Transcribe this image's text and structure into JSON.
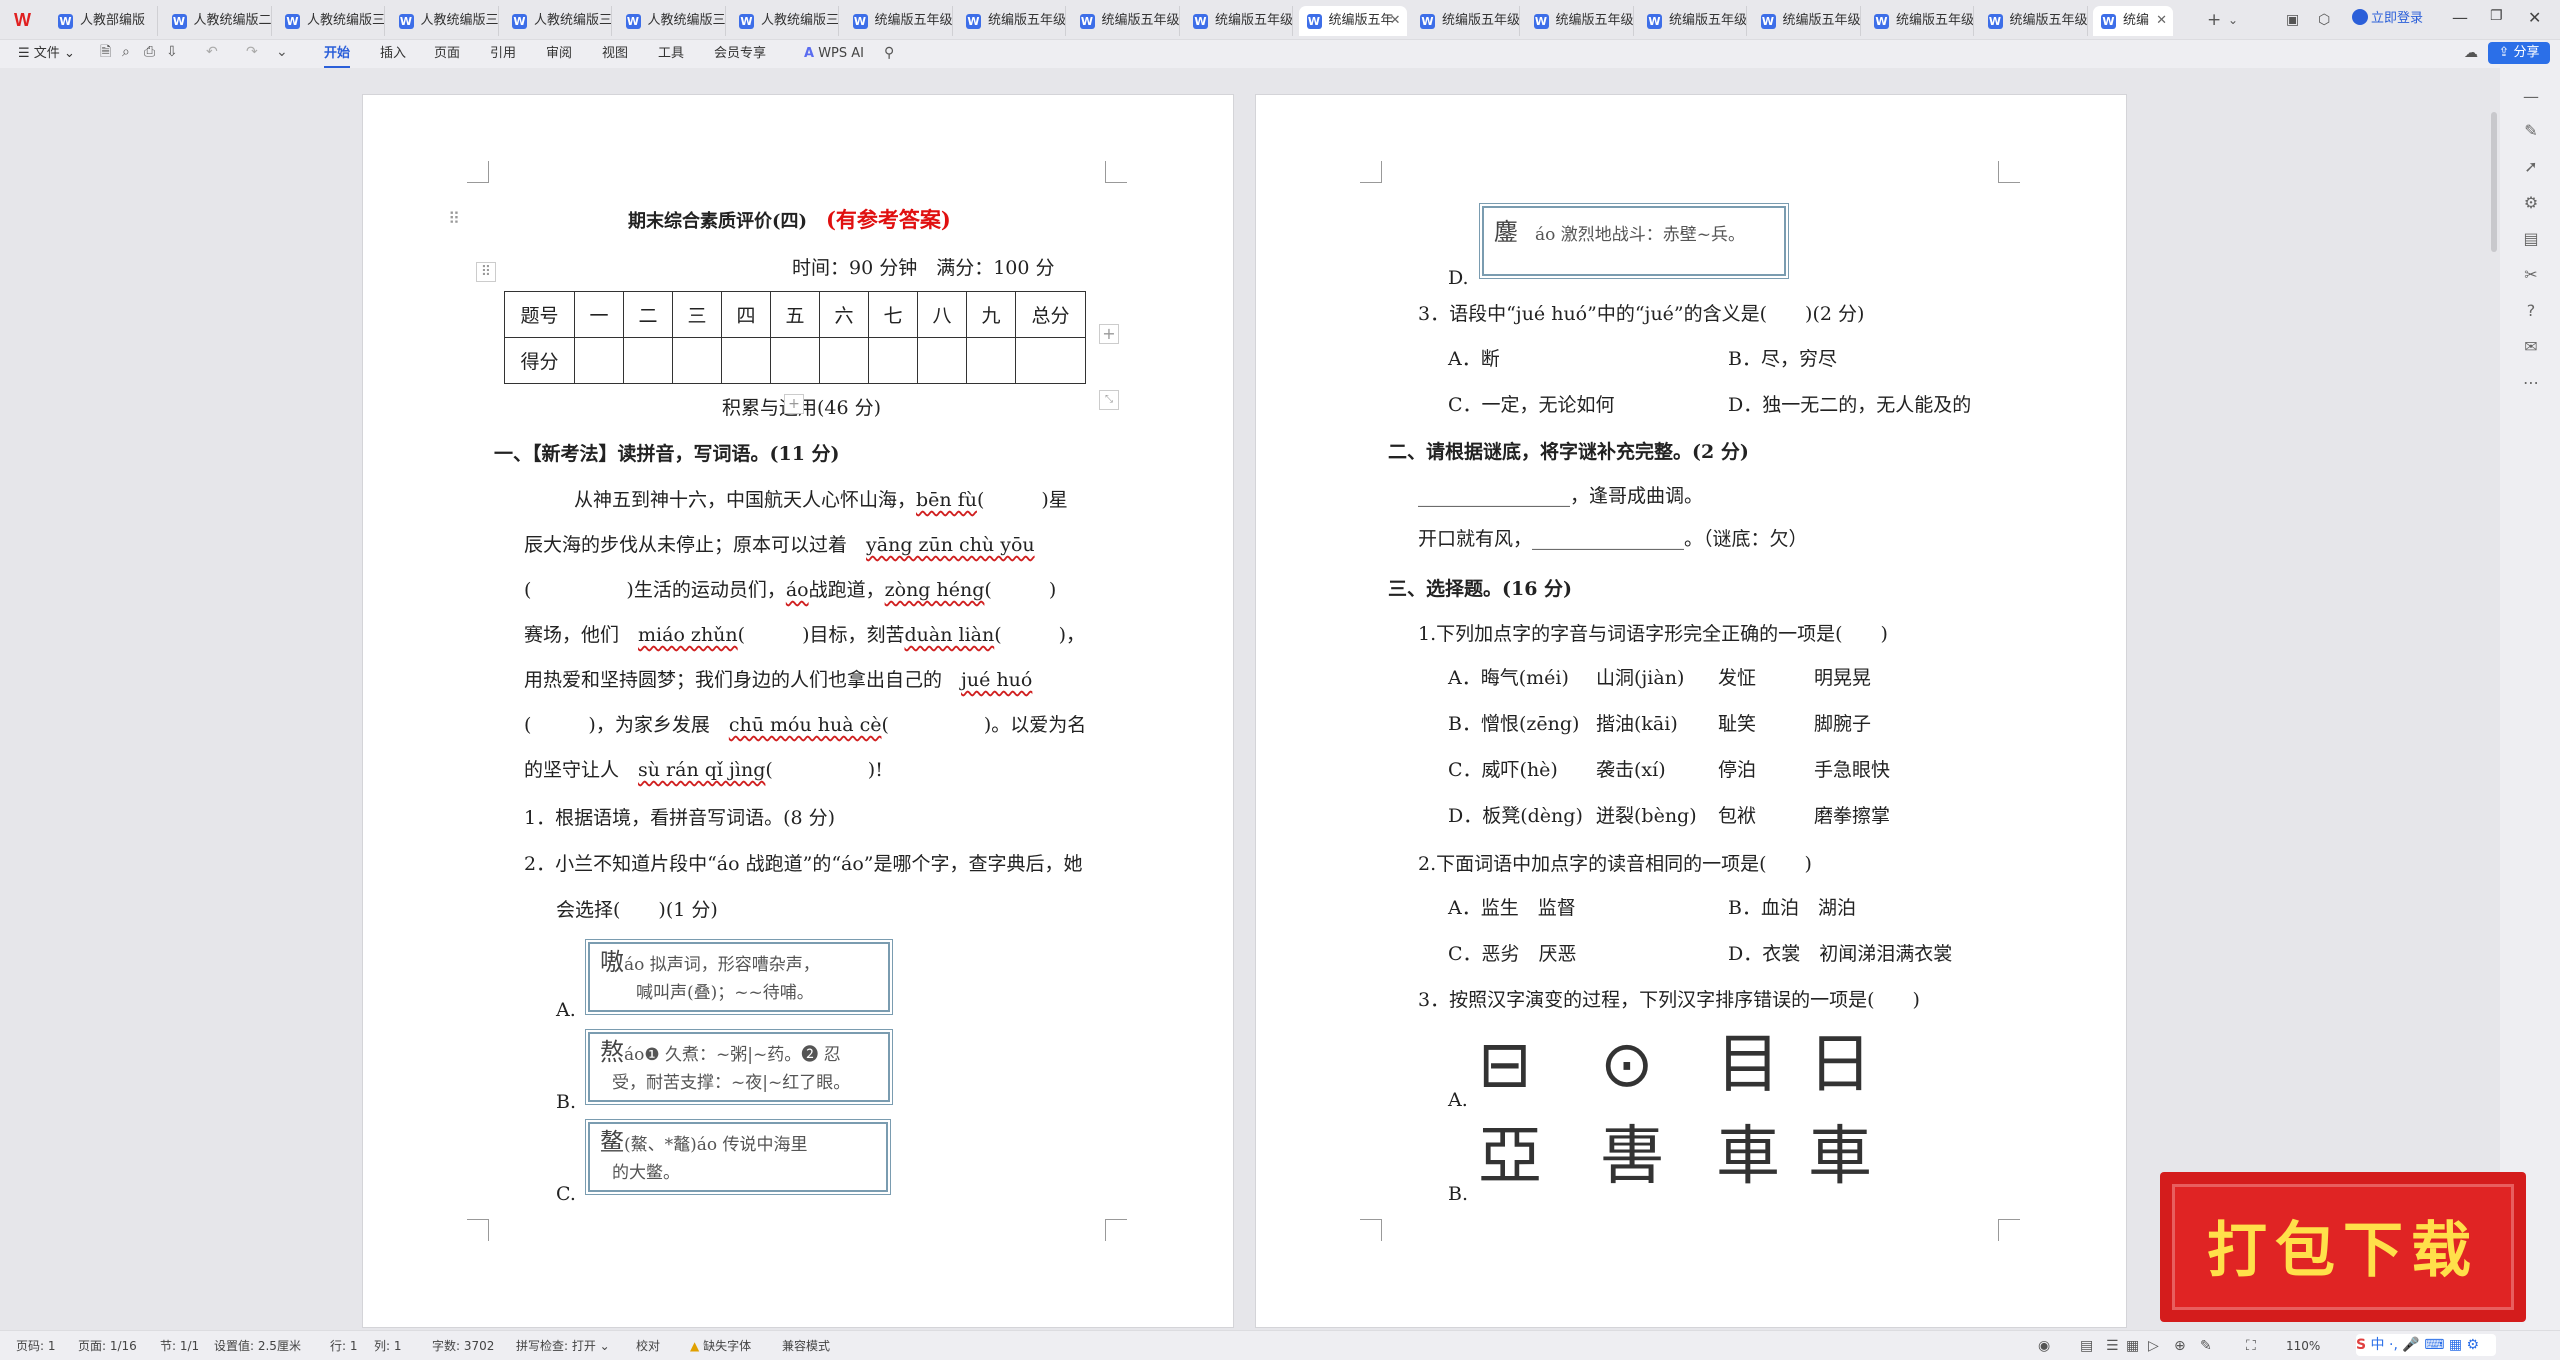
{
  "tabs": [
    {
      "label": "人教部编版"
    },
    {
      "label": "人教统编版二"
    },
    {
      "label": "人教统编版三"
    },
    {
      "label": "人教统编版三"
    },
    {
      "label": "人教统编版三"
    },
    {
      "label": "人教统编版三"
    },
    {
      "label": "人教统编版三"
    },
    {
      "label": "统编版五年级"
    },
    {
      "label": "统编版五年级"
    },
    {
      "label": "统编版五年级"
    },
    {
      "label": "统编版五年级"
    },
    {
      "label": "统编版五年"
    },
    {
      "label": "统编版五年级"
    },
    {
      "label": "统编版五年级"
    },
    {
      "label": "统编版五年级"
    },
    {
      "label": "统编版五年级"
    },
    {
      "label": "统编版五年级"
    },
    {
      "label": "统编版五年级"
    },
    {
      "label": "统编"
    }
  ],
  "login_label": "立即登录",
  "menu": {
    "file": "文件",
    "items": [
      "开始",
      "插入",
      "页面",
      "引用",
      "审阅",
      "视图",
      "工具",
      "会员专享"
    ],
    "wps_ai": "WPS AI",
    "share": "分享"
  },
  "page1": {
    "title": "期末综合素质评价(四)",
    "title_note": "(有参考答案)",
    "time_line": "时间：90 分钟　满分：100 分",
    "table_header": [
      "题号",
      "一",
      "二",
      "三",
      "四",
      "五",
      "六",
      "七",
      "八",
      "九",
      "总分"
    ],
    "table_row_label": "得分",
    "section": "积累与运用(46 分)",
    "q1_title": "一、【新考法】读拼音，写词语。(11 分)",
    "q1_lines": [
      "从神五到神十六，中国航天人心怀山海，",
      "辰大海的步伐从未停止；原本可以过着",
      "(　　　　　)生活的运动员们，",
      "赛场，他们",
      "用热爱和坚持圆梦；我们身边的人们也拿出自己的",
      "(　　　)，为家乡发展",
      "的坚守让人"
    ],
    "pinyin": {
      "p1": "bēn fù",
      "p2": "yāng zūn chù yōu",
      "p3": "áo",
      "p4": "zòng héng",
      "p5": "miáo zhǔn",
      "p6": "duàn liàn",
      "p7": "jué huó",
      "p8": "chū móu huà cè",
      "p9": "sù rán qǐ jìng"
    },
    "q1_frags": {
      "f1": "(　　　)星",
      "f2": "战跑道，",
      "f3": "(　　　)",
      "f4": "(　　　)目标，刻苦",
      "f5": "(　　　)，",
      "f6": "(　　　　　)。以爱为名",
      "f7": "(　　　　　)!"
    },
    "sub1": "1．根据语境，看拼音写词语。(8 分)",
    "sub2a": "2．小兰不知道片段中“áo 战跑道”的“áo”是哪个字，查字典后，她",
    "sub2b": "会选择(　　)(1 分)",
    "optA": "A.",
    "optB": "B.",
    "optC": "C.",
    "dictA": {
      "char": "嗷",
      "text1": "áo 拟声词，形容嘈杂声，",
      "text2": "喊叫声(叠)；~~待哺。"
    },
    "dictB": {
      "char": "熬",
      "text1": "áo❶ 久煮：~粥|~药。❷ 忍",
      "text2": "受，耐苦支撑：~夜|~红了眼。"
    },
    "dictC": {
      "char": "鳌",
      "text1": "(鰲、*鼇)áo 传说中海里",
      "text2": "的大鳖。"
    }
  },
  "page2": {
    "optD": "D.",
    "dictD": {
      "char": "鏖",
      "text1": "áo 激烈地战斗：赤壁~兵。"
    },
    "q3": "3．语段中“jué huó”中的“jué”的含义是(　　)(2 分)",
    "q3a": "A．断",
    "q3b": "B．尽，穷尽",
    "q3c": "C．一定，无论如何",
    "q3d": "D．独一无二的，无人能及的",
    "s2": "二、请根据谜底，将字谜补充完整。(2 分)",
    "s2l1": "________________，逢哥成曲调。",
    "s2l2": "开口就有风，________________。（谜底：欠）",
    "s3": "三、选择题。(16 分)",
    "c1": "1.下列加点字的字音与词语字形完全正确的一项是(　　)",
    "c1rows": [
      [
        "A．晦气(méi)",
        "山洞(jiàn)",
        "发怔",
        "明晃晃"
      ],
      [
        "B．憎恨(zēng)",
        "揩油(kāi)",
        "耻笑",
        "脚腕子"
      ],
      [
        "C．威吓(hè)",
        "袭击(xí)",
        "停泊",
        "手急眼快"
      ],
      [
        "D．板凳(dèng)",
        "迸裂(bèng)",
        "包袱",
        "磨拳擦掌"
      ]
    ],
    "c2": "2.下面词语中加点字的读音相同的一项是(　　)",
    "c2rows": [
      [
        "A．监生　监督",
        "B．血泊　湖泊"
      ],
      [
        "C．恶劣　厌恶",
        "D．衣裳　初闻涕泪满衣裳"
      ]
    ],
    "c3": "3．按照汉字演变的过程，下列汉字排序错误的一项是(　　)",
    "c3a": "A.",
    "c3b": "B.",
    "glyphsA": [
      "⊟",
      "⊙",
      "目",
      "日"
    ],
    "glyphsB": [
      "亞",
      "軎",
      "車",
      "車"
    ]
  },
  "banner": "打包下载",
  "status": {
    "page": "页码: 1",
    "pages": "页面: 1/16",
    "section": "节: 1/1",
    "setting": "设置值: 2.5厘米",
    "row": "行: 1",
    "col": "列: 1",
    "words": "字数: 3702",
    "spell": "拼写检查: 打开",
    "proof": "校对",
    "font": "缺失字体",
    "compat": "兼容模式",
    "zoom": "110%"
  }
}
